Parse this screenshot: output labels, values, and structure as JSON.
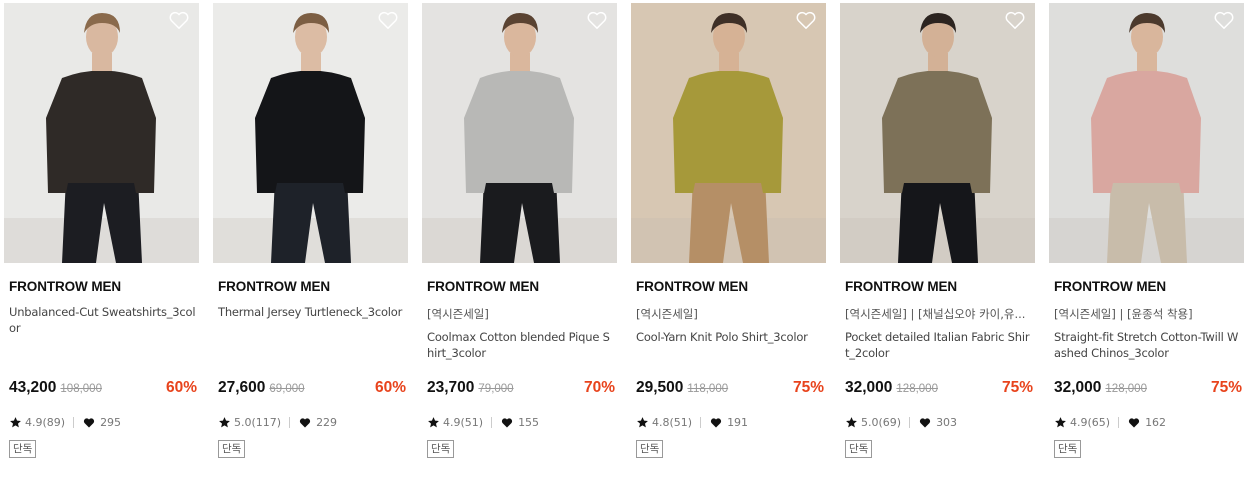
{
  "products": [
    {
      "brand": "FRONTROW MEN",
      "promo": "",
      "name": "Unbalanced-Cut Sweatshirts_3color",
      "price": "43,200",
      "original_price": "108,000",
      "discount": "60%",
      "rating": "4.9(89)",
      "likes": "295",
      "badge": "단독",
      "bg": "#e9e9e7",
      "top_color": "#2f2a27",
      "bottom_color": "#1c1d22",
      "skin": "#d9b8a0",
      "hair": "#8a6a4c"
    },
    {
      "brand": "FRONTROW MEN",
      "promo": "",
      "name": "Thermal Jersey Turtleneck_3color",
      "price": "27,600",
      "original_price": "69,000",
      "discount": "60%",
      "rating": "5.0(117)",
      "likes": "229",
      "badge": "단독",
      "bg": "#ebebe9",
      "top_color": "#141518",
      "bottom_color": "#1e2229",
      "skin": "#dcbca4",
      "hair": "#7c5e43"
    },
    {
      "brand": "FRONTROW MEN",
      "promo": "[역시즌세일]",
      "name": "Coolmax Cotton blended Pique Shirt_3color",
      "price": "23,700",
      "original_price": "79,000",
      "discount": "70%",
      "rating": "4.9(51)",
      "likes": "155",
      "badge": "단독",
      "bg": "#e4e3e1",
      "top_color": "#b8b8b6",
      "bottom_color": "#1a1b1e",
      "skin": "#dab79d",
      "hair": "#5a4332"
    },
    {
      "brand": "FRONTROW MEN",
      "promo": "[역시즌세일]",
      "name": "Cool-Yarn Knit Polo Shirt_3color",
      "price": "29,500",
      "original_price": "118,000",
      "discount": "75%",
      "rating": "4.8(51)",
      "likes": "191",
      "badge": "단독",
      "bg": "#d7c7b3",
      "top_color": "#a6993a",
      "bottom_color": "#b58f66",
      "skin": "#d6b295",
      "hair": "#3e2f26"
    },
    {
      "brand": "FRONTROW MEN",
      "promo": "[역시즌세일] | [채널십오야 카이,유...",
      "name": "Pocket detailed Italian Fabric Shirt_2color",
      "price": "32,000",
      "original_price": "128,000",
      "discount": "75%",
      "rating": "5.0(69)",
      "likes": "303",
      "badge": "단독",
      "bg": "#d8d3cb",
      "top_color": "#7d7158",
      "bottom_color": "#15161a",
      "skin": "#d3b196",
      "hair": "#2c2420"
    },
    {
      "brand": "FRONTROW MEN",
      "promo": "[역시즌세일] | [윤종석 착용]",
      "name": "Straight-fit Stretch Cotton-Twill Washed Chinos_3color",
      "price": "32,000",
      "original_price": "128,000",
      "discount": "75%",
      "rating": "4.9(65)",
      "likes": "162",
      "badge": "단독",
      "bg": "#dededc",
      "top_color": "#d9a7a0",
      "bottom_color": "#c8bcaa",
      "skin": "#d9b69c",
      "hair": "#4c3a2d"
    }
  ],
  "icons": {
    "wishlist": "heart-outline-icon",
    "rating": "star-icon",
    "likes": "heart-filled-icon"
  },
  "colors": {
    "discount": "#e8431c",
    "price": "#111111",
    "muted": "#777777"
  }
}
